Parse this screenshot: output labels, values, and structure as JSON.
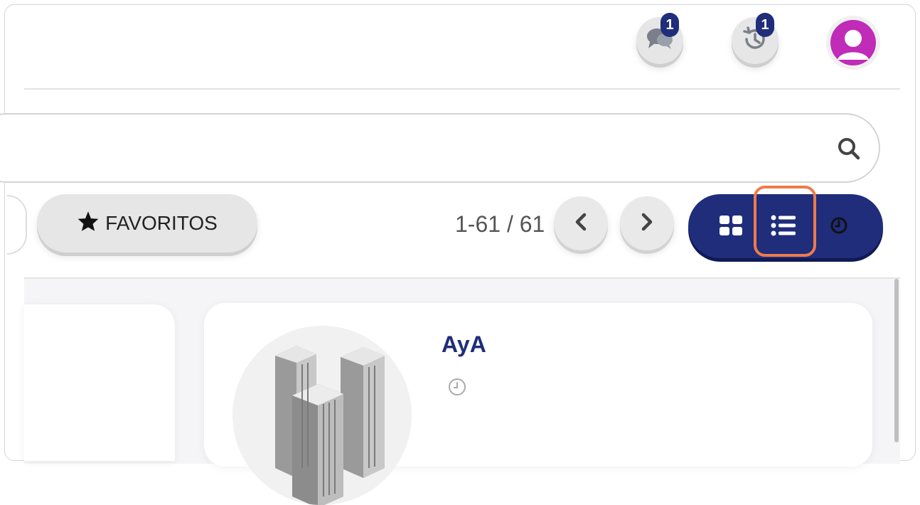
{
  "header": {
    "chat_badge": "1",
    "history_badge": "1"
  },
  "search": {
    "value": "",
    "placeholder": ""
  },
  "toolbar": {
    "favorites_label": "FAVORITOS",
    "pagination": "1-61 / 61"
  },
  "card": {
    "title": "AyA"
  },
  "colors": {
    "primary": "#1f2d7a",
    "highlight": "#f07a4a",
    "avatar": "#c02bb8"
  }
}
